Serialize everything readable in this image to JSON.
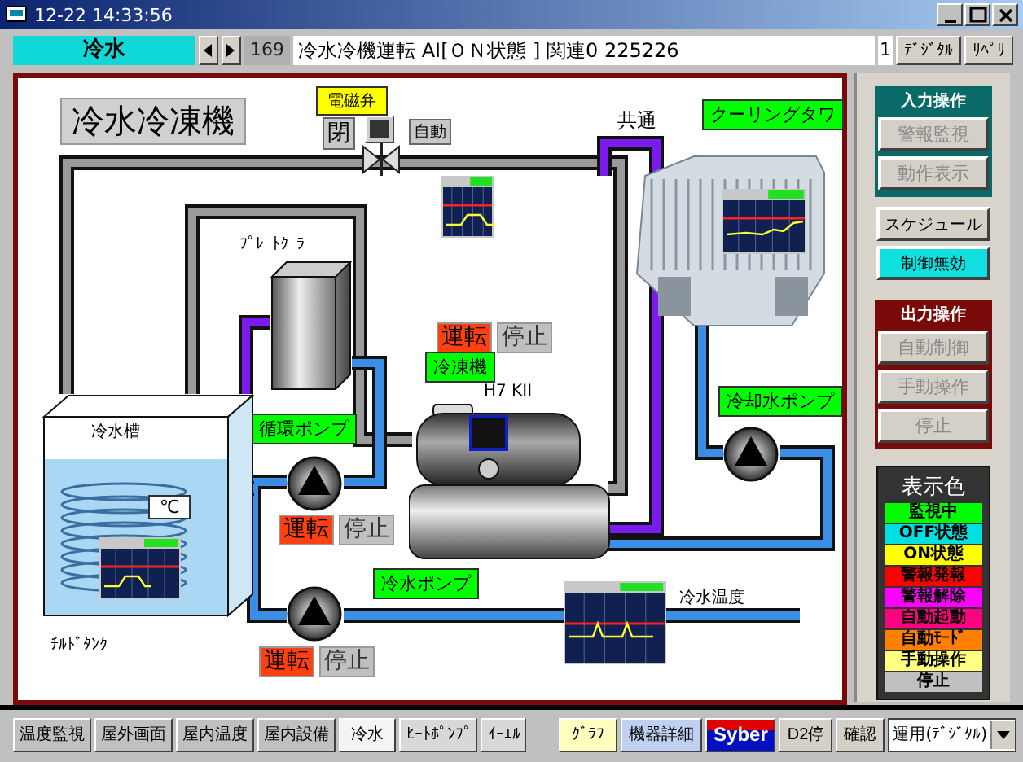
{
  "window": {
    "title": "12-22 14:33:56"
  },
  "toolbar": {
    "screen": "冷水",
    "point_no": "169",
    "message": "冷水冷機運転 AI[ＯＮ状態 ] 関連0 225226",
    "count": "1",
    "buttons": [
      "ﾃﾞｼﾞﾀﾙ",
      "ﾘﾍﾟﾘ"
    ]
  },
  "diagram": {
    "title": "冷水冷凍機",
    "valve": {
      "label": "電磁弁",
      "close_label": "閉",
      "mode": "自動"
    },
    "labels": {
      "common": "共通",
      "tower": "クーリングタワ",
      "plate_cooler": "ﾌﾟﾚｰﾄｸｰﾗ",
      "chiller": "冷凍機",
      "chiller_model": "H7 KII",
      "cooling_pump": "冷却水ポンプ",
      "circulation_pump": "循環ポンプ",
      "chilled_pump": "冷水ポンプ",
      "tank": "冷水槽",
      "unit": "℃",
      "tank_name": "ﾁﾙﾄﾞﾀﾝｸ",
      "temperature": "冷水温度"
    },
    "status": [
      {
        "run": "運転",
        "stop": "停止",
        "running": true
      },
      {
        "run": "運転",
        "stop": "停止",
        "running": true
      },
      {
        "run": "運転",
        "stop": "停止",
        "running": true
      }
    ]
  },
  "input_ops": {
    "title": "入力操作",
    "buttons": [
      {
        "label": "警報監視",
        "disabled": true
      },
      {
        "label": "動作表示",
        "disabled": true
      }
    ]
  },
  "mode_buttons": [
    {
      "label": "スケジュール",
      "selected": false
    },
    {
      "label": "制御無効",
      "selected": true
    }
  ],
  "output_ops": {
    "title": "出力操作",
    "buttons": [
      {
        "label": "自動制御",
        "disabled": true
      },
      {
        "label": "手動操作",
        "disabled": true
      },
      {
        "label": "停止",
        "disabled": true
      }
    ]
  },
  "legend": {
    "title": "表示色",
    "items": [
      {
        "label": "監視中",
        "color": "#00ff00"
      },
      {
        "label": "OFF状態",
        "color": "#00e0e0"
      },
      {
        "label": "ON状態",
        "color": "#ffff00"
      },
      {
        "label": "警報発報",
        "color": "#ff0000"
      },
      {
        "label": "警報解除",
        "color": "#ff00ff"
      },
      {
        "label": "自動起動",
        "color": "#ff0080"
      },
      {
        "label": "自動ﾓｰﾄﾞ",
        "color": "#ff8000"
      },
      {
        "label": "手動操作",
        "color": "#ffff80"
      },
      {
        "label": "停止",
        "color": "#c0c0c0"
      }
    ]
  },
  "bottom_tabs": [
    {
      "label": "温度監視",
      "selected": false
    },
    {
      "label": "屋外画面",
      "selected": false
    },
    {
      "label": "屋内温度",
      "selected": false
    },
    {
      "label": "屋内設備",
      "selected": false
    },
    {
      "label": "冷水",
      "selected": true
    },
    {
      "label": "ﾋｰﾄﾎﾟﾝﾌﾟ",
      "selected": false
    },
    {
      "label": "ｲｰｴﾙ",
      "selected": false
    }
  ],
  "tools": [
    {
      "label": "ｸﾞﾗﾌ",
      "kind": "graph"
    },
    {
      "label": "機器詳細",
      "kind": "detail"
    },
    {
      "label": "Syber",
      "kind": "logo"
    },
    {
      "label": "D2停",
      "kind": "plain"
    },
    {
      "label": "確認",
      "kind": "plain"
    }
  ],
  "mode_select": {
    "value": "運用(ﾃﾞｼﾞﾀﾙ)"
  }
}
